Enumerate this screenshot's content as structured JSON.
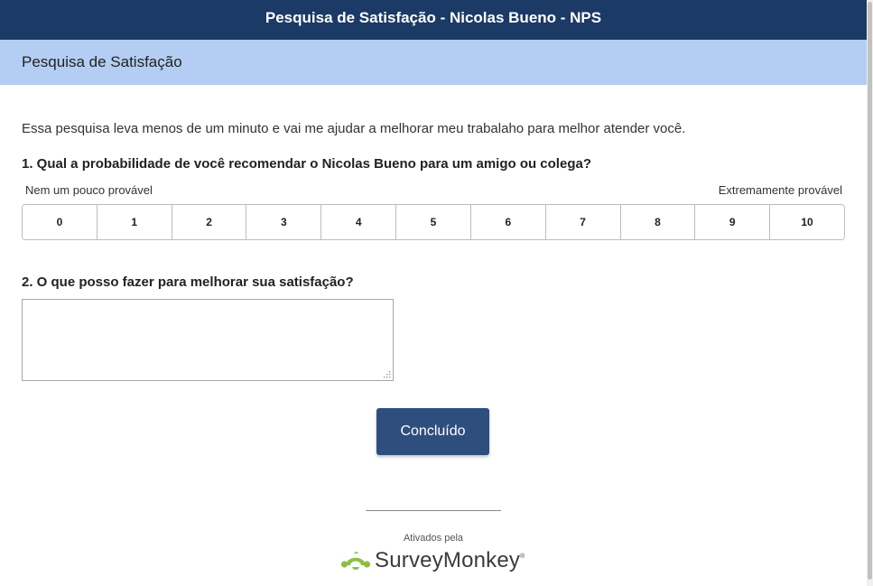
{
  "header": {
    "title": "Pesquisa de Satisfação - Nicolas Bueno - NPS"
  },
  "page": {
    "subtitle": "Pesquisa de Satisfação"
  },
  "intro": {
    "text": "Essa pesquisa leva menos de um minuto e vai me ajudar a melhorar meu trabalaho para melhor atender você."
  },
  "question1": {
    "title": "1. Qual a probabilidade de você recomendar o Nicolas Bueno para um amigo ou colega?",
    "low_label": "Nem um pouco provável",
    "high_label": "Extremamente provável",
    "options": [
      "0",
      "1",
      "2",
      "3",
      "4",
      "5",
      "6",
      "7",
      "8",
      "9",
      "10"
    ]
  },
  "question2": {
    "title": "2. O que posso fazer para melhorar sua satisfação?",
    "value": ""
  },
  "actions": {
    "done_label": "Concluído"
  },
  "footer": {
    "powered_by": "Ativados pela",
    "brand": "SurveyMonkey",
    "registered": "®"
  },
  "colors": {
    "header_bg": "#1b3a66",
    "subheader_bg": "#b4cdf2",
    "button_bg": "#2e4e7e",
    "logo_green": "#8dbf42"
  },
  "icons": {
    "logo": "surveymonkey-logo-icon",
    "resize": "resize-handle-icon"
  }
}
